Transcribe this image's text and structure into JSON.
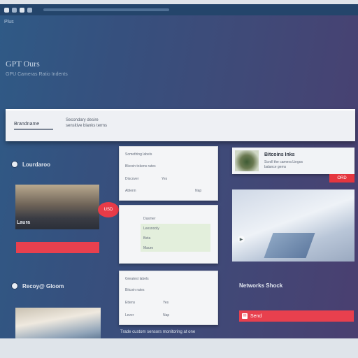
{
  "colors": {
    "accent": "#e8404e",
    "window_bg": "#36507e",
    "panel_bg": "#f4f5f7"
  },
  "browser": {
    "address": "Plus"
  },
  "hero": {
    "title": "GPT Ours",
    "subtitle": "GPU Cameras Ratio Indents"
  },
  "banner": {
    "name": "Brandname",
    "description": "Secondary desire sensitive blanks terms"
  },
  "left_column": {
    "section1_title": "Lourdaroo",
    "image_label": "Laura",
    "badge": "USD",
    "section2_title": "Recoy@ Gloom"
  },
  "panel_a": {
    "rows": [
      {
        "label": "Something labels",
        "value": ""
      },
      {
        "label": "Bkcoin tokens rates",
        "value": ""
      },
      {
        "label": "Discover",
        "value": "Yes"
      },
      {
        "label": "Ablenn",
        "value": "Nap"
      }
    ]
  },
  "panel_b": {
    "rows": [
      "Dasmer",
      "Leesnooly",
      "Beta",
      "Mauro"
    ]
  },
  "panel_c": {
    "rows": [
      {
        "label": "Greatest labels",
        "value": ""
      },
      {
        "label": "Bitcoin rates",
        "value": ""
      },
      {
        "label": "Ettens",
        "value": "Yes"
      },
      {
        "label": "Lever",
        "value": "Nap"
      }
    ],
    "footer": "Trade custom sensors monitoring at one"
  },
  "product": {
    "title": "Bitcoins Inks",
    "description": "Scroll the camera Lingos balance gems",
    "tag": "ORD"
  },
  "right_column": {
    "section_title": "Networks Shock",
    "button_label": "Send"
  }
}
